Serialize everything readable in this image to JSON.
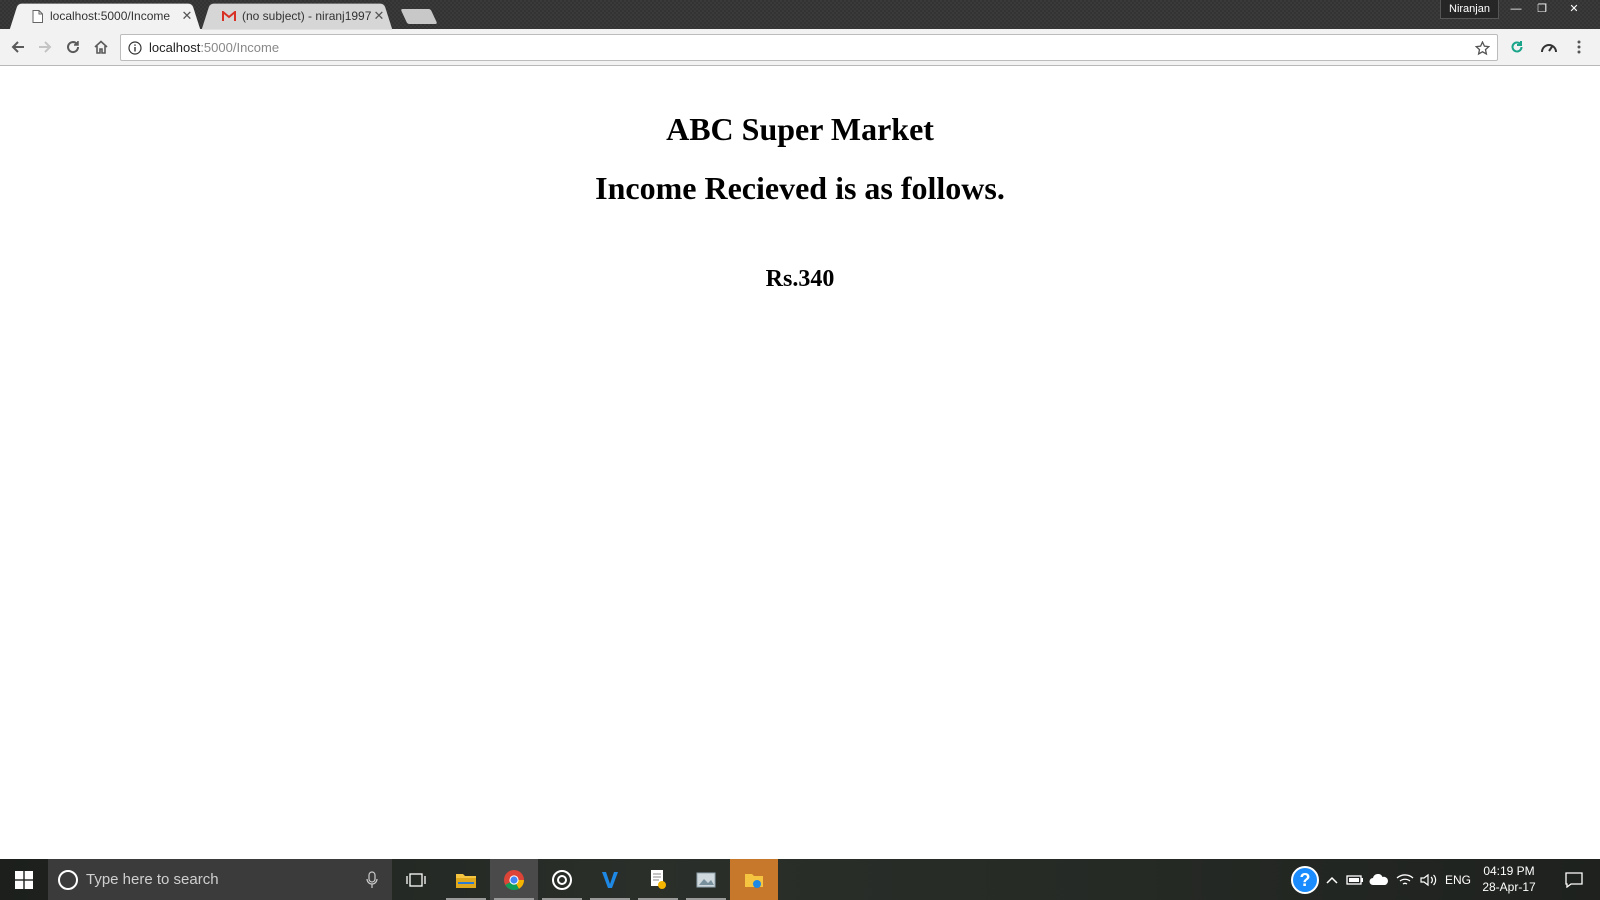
{
  "browser": {
    "tabs": [
      {
        "label": "localhost:5000/Income",
        "favicon": "page-icon",
        "active": true
      },
      {
        "label": "(no subject) - niranj1997",
        "favicon": "gmail-icon",
        "active": false
      }
    ],
    "tab_close": "✕",
    "profile_name": "Niranjan",
    "window_controls": {
      "minimize": "—",
      "restore": "❐",
      "close": "✕"
    },
    "url_host": "localhost",
    "url_path": ":5000/Income"
  },
  "page": {
    "title": "ABC Super Market",
    "subtitle": "Income Recieved is as follows.",
    "amount": "Rs.340"
  },
  "taskbar": {
    "search_placeholder": "Type here to search",
    "language": "ENG",
    "time": "04:19 PM",
    "date": "28-Apr-17"
  },
  "colors": {
    "gmail_red": "#d93025",
    "chrome_green": "#0f9d58",
    "chrome_red": "#db4437",
    "chrome_yellow": "#f4b400",
    "chrome_blue": "#4285f4",
    "help_blue": "#1a8cff",
    "accent_orange": "#c8782a"
  }
}
